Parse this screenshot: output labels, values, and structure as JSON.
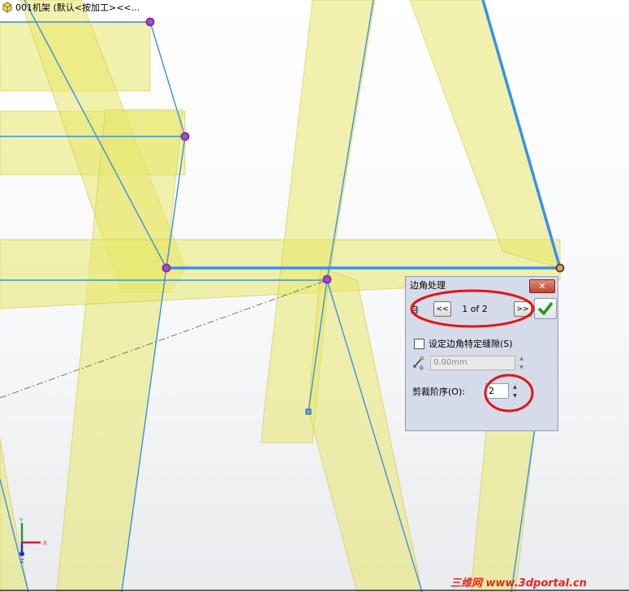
{
  "tree": {
    "title": "001机架 (默认<按加工><<..."
  },
  "dialog": {
    "title": "边角处理",
    "close_label": "✕",
    "prev_label": "<<",
    "next_label": ">>",
    "counter": "1 of 2",
    "row_label": "自",
    "ok_icon": "checkmark-icon",
    "gap_checkbox_label": "设定边角特定缝隙(S)",
    "gap_checkbox_checked": false,
    "gap_value": "0.00mm",
    "trim_order_label": "剪裁阶序(O):",
    "trim_order_value": "2"
  },
  "triad": {
    "y_label": "Y",
    "x_label": "X",
    "z_label": "Z"
  },
  "watermark": {
    "text": "三维网 www.3dportal.cn"
  },
  "colors": {
    "beam_fill": "#e9e870",
    "edge_line": "#3b8fe8",
    "highlight_edge": "#3a8ff0",
    "dialog_bg": "#d6dbe9",
    "annotation_circle": "#e51515"
  }
}
